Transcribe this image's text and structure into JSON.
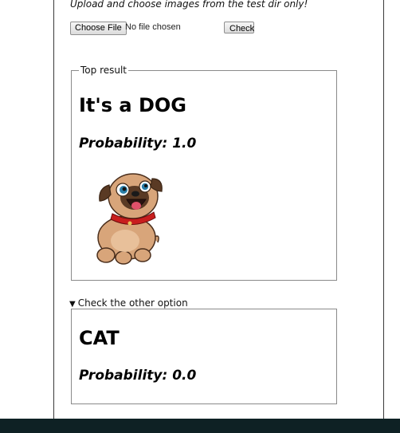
{
  "upload": {
    "instructions": "Upload and choose images from the test dir only!",
    "choose_file_label": "Choose File",
    "file_status": "No file chosen",
    "check_label": "Check"
  },
  "top_result": {
    "legend": "Top result",
    "heading": "It's a DOG",
    "probability_text": "Probability: 1.0"
  },
  "other_option": {
    "summary": "Check the other option",
    "heading": "CAT",
    "probability_text": "Probability: 0.0"
  },
  "colors": {
    "page_background": "#ffffff",
    "bottom_bar": "#0e2124",
    "panel_border": "#8a8a8a"
  },
  "icons": {
    "disclosure": "triangle-down-icon"
  }
}
